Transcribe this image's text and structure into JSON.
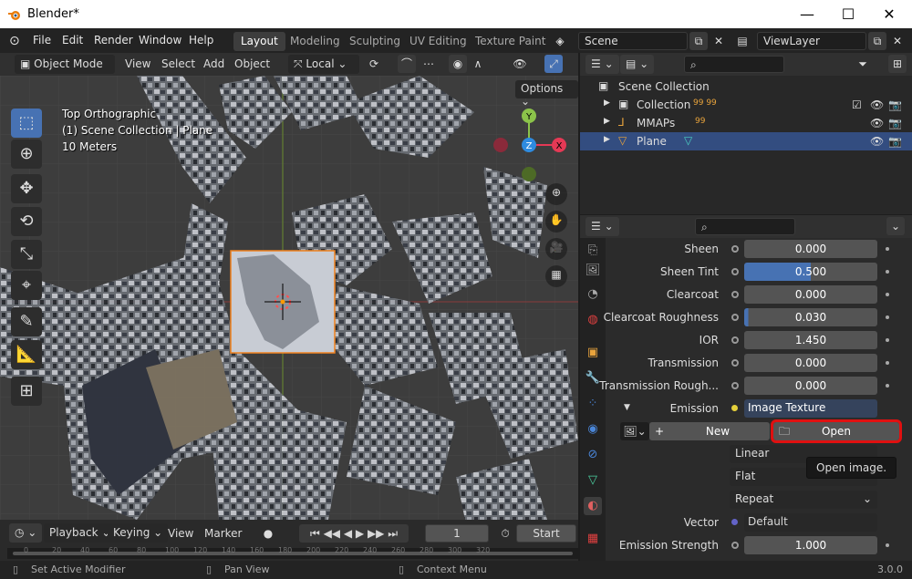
{
  "window": {
    "title": "Blender*"
  },
  "menu": [
    "File",
    "Edit",
    "Render",
    "Window",
    "Help"
  ],
  "workspaces": [
    "Layout",
    "Modeling",
    "Sculpting",
    "UV Editing",
    "Texture Paint"
  ],
  "scene": "Scene",
  "view_layer": "ViewLayer",
  "viewport": {
    "mode": "Object Mode",
    "menus": [
      "View",
      "Select",
      "Add",
      "Object"
    ],
    "transform": "Local",
    "options": "Options",
    "overlay": {
      "view": "Top Orthographic",
      "collection": "(1) Scene Collection | Plane",
      "scale": "10 Meters"
    },
    "axes": {
      "y": "Y",
      "z": "Z",
      "x": "X"
    }
  },
  "timeline": {
    "menus": [
      "Playback",
      "Keying",
      "View",
      "Marker"
    ],
    "frame": "1",
    "start_label": "Start",
    "ticks": [
      "0",
      "20",
      "40",
      "60",
      "80",
      "100",
      "120",
      "140",
      "160",
      "180",
      "200",
      "220",
      "240",
      "260",
      "280",
      "300",
      "320"
    ]
  },
  "outliner": {
    "root": "Scene Collection",
    "rows": [
      {
        "label": "Collection",
        "badges": "99 99"
      },
      {
        "label": "MMAPs",
        "badges": "99"
      },
      {
        "label": "Plane",
        "badges": ""
      }
    ]
  },
  "properties": {
    "rows": [
      {
        "label": "Sheen",
        "value": "0.000"
      },
      {
        "label": "Sheen Tint",
        "value": "0.500"
      },
      {
        "label": "Clearcoat",
        "value": "0.000"
      },
      {
        "label": "Clearcoat Roughness",
        "value": "0.030"
      },
      {
        "label": "IOR",
        "value": "1.450"
      },
      {
        "label": "Transmission",
        "value": "0.000"
      },
      {
        "label": "Transmission Rough...",
        "value": "0.000"
      }
    ],
    "emission_label": "Emission",
    "emission_value": "Image Texture",
    "new_label": "New",
    "open_label": "Open",
    "interp": "Linear",
    "proj": "Flat",
    "ext": "Repeat",
    "vector_label": "Vector",
    "vector_value": "Default",
    "strength_label": "Emission Strength",
    "strength_value": "1.000",
    "tooltip": "Open image."
  },
  "status": {
    "left": "Set Active Modifier",
    "mid": "Pan View",
    "right": "Context Menu",
    "version": "3.0.0"
  },
  "colors": {
    "accent": "#4772b3",
    "highlight": "#ff0000",
    "selected": "#334d80"
  }
}
